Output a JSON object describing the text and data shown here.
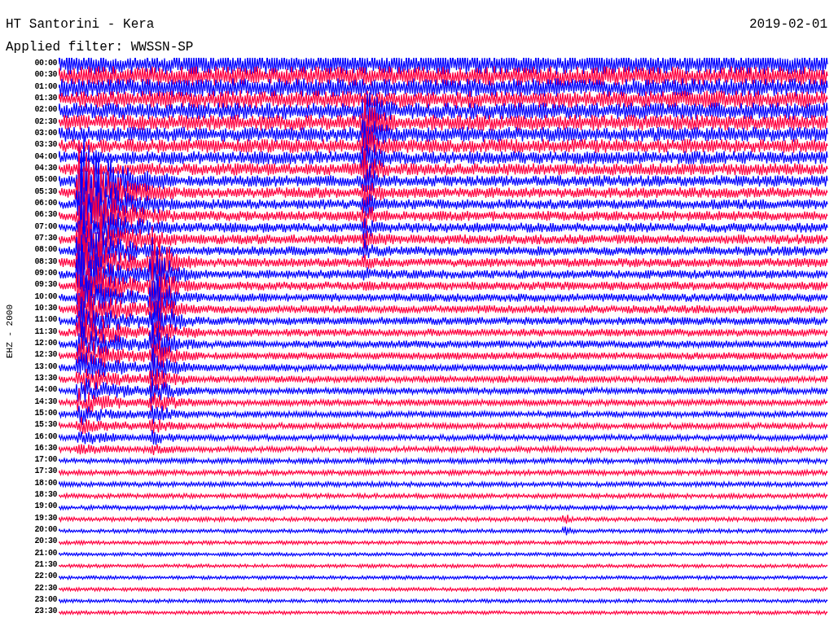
{
  "header": {
    "station": "HT Santorini - Kera",
    "date": "2019-02-01",
    "filter": "Applied filter: WWSSN-SP"
  },
  "channel": "EHZ - 2000",
  "rows": [
    {
      "time": "00:00",
      "color": "#0000ff"
    },
    {
      "time": "00:30",
      "color": "#ff0040"
    },
    {
      "time": "01:00",
      "color": "#0000ff"
    },
    {
      "time": "01:30",
      "color": "#ff0040"
    },
    {
      "time": "02:00",
      "color": "#0000ff"
    },
    {
      "time": "02:30",
      "color": "#ff0040"
    },
    {
      "time": "03:00",
      "color": "#0000ff"
    },
    {
      "time": "03:30",
      "color": "#ff0040"
    },
    {
      "time": "04:00",
      "color": "#0000ff"
    },
    {
      "time": "04:30",
      "color": "#ff0040"
    },
    {
      "time": "05:00",
      "color": "#0000ff"
    },
    {
      "time": "05:30",
      "color": "#ff0040"
    },
    {
      "time": "06:00",
      "color": "#0000ff"
    },
    {
      "time": "06:30",
      "color": "#ff0040"
    },
    {
      "time": "07:00",
      "color": "#0000ff"
    },
    {
      "time": "07:30",
      "color": "#ff0040"
    },
    {
      "time": "08:00",
      "color": "#0000ff"
    },
    {
      "time": "08:30",
      "color": "#ff0040"
    },
    {
      "time": "09:00",
      "color": "#0000ff"
    },
    {
      "time": "09:30",
      "color": "#ff0040"
    },
    {
      "time": "10:00",
      "color": "#0000ff"
    },
    {
      "time": "10:30",
      "color": "#ff0040"
    },
    {
      "time": "11:00",
      "color": "#0000ff"
    },
    {
      "time": "11:30",
      "color": "#ff0040"
    },
    {
      "time": "12:00",
      "color": "#0000ff"
    },
    {
      "time": "12:30",
      "color": "#ff0040"
    },
    {
      "time": "13:00",
      "color": "#0000ff"
    },
    {
      "time": "13:30",
      "color": "#ff0040"
    },
    {
      "time": "14:00",
      "color": "#0000ff"
    },
    {
      "time": "14:30",
      "color": "#ff0040"
    },
    {
      "time": "15:00",
      "color": "#0000ff"
    },
    {
      "time": "15:30",
      "color": "#ff0040"
    },
    {
      "time": "16:00",
      "color": "#0000ff"
    },
    {
      "time": "16:30",
      "color": "#ff0040"
    },
    {
      "time": "17:00",
      "color": "#0000ff"
    },
    {
      "time": "17:30",
      "color": "#ff0040"
    },
    {
      "time": "18:00",
      "color": "#0000ff"
    },
    {
      "time": "18:30",
      "color": "#ff0040"
    },
    {
      "time": "19:00",
      "color": "#0000ff"
    },
    {
      "time": "19:30",
      "color": "#ff0040"
    },
    {
      "time": "20:00",
      "color": "#0000ff"
    },
    {
      "time": "20:30",
      "color": "#ff0040"
    },
    {
      "time": "21:00",
      "color": "#0000ff"
    },
    {
      "time": "21:30",
      "color": "#ff0040"
    },
    {
      "time": "22:00",
      "color": "#0000ff"
    },
    {
      "time": "22:30",
      "color": "#ff0040"
    },
    {
      "time": "23:00",
      "color": "#0000ff"
    },
    {
      "time": "23:30",
      "color": "#ff0040"
    }
  ]
}
